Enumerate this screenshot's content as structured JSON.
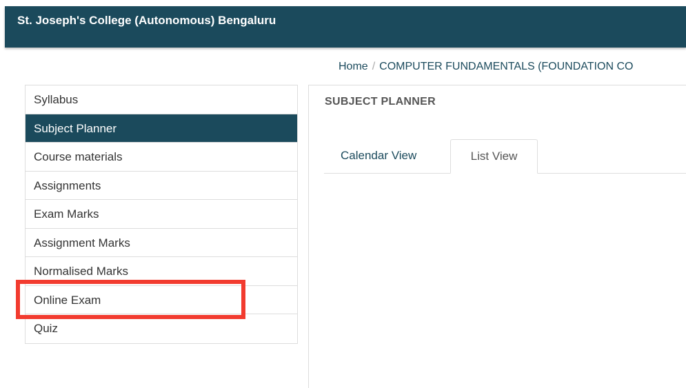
{
  "header": {
    "title": "St. Joseph's College (Autonomous) Bengaluru"
  },
  "breadcrumb": {
    "home": "Home",
    "separator": "/",
    "current": "COMPUTER FUNDAMENTALS (FOUNDATION CO"
  },
  "sidebar": {
    "items": [
      {
        "label": "Syllabus",
        "active": false
      },
      {
        "label": "Subject Planner",
        "active": true
      },
      {
        "label": "Course materials",
        "active": false
      },
      {
        "label": "Assignments",
        "active": false
      },
      {
        "label": "Exam Marks",
        "active": false
      },
      {
        "label": "Assignment Marks",
        "active": false
      },
      {
        "label": "Normalised Marks",
        "active": false
      },
      {
        "label": "Online Exam",
        "active": false
      },
      {
        "label": "Quiz",
        "active": false
      }
    ]
  },
  "main": {
    "panel_title": "SUBJECT PLANNER",
    "tabs": [
      {
        "label": "Calendar View",
        "active": false
      },
      {
        "label": "List View",
        "active": true
      }
    ]
  },
  "colors": {
    "header_bg": "#1b4a5c",
    "active_item_bg": "#1b4a5c",
    "highlight_border": "#f23b2f"
  }
}
